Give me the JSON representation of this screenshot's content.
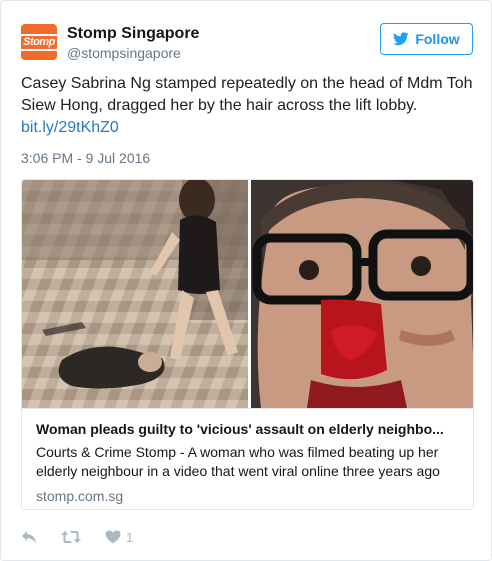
{
  "account": {
    "display_name": "Stomp Singapore",
    "handle": "@stompsingapore",
    "avatar_text": "Stomp"
  },
  "follow_button": {
    "label": "Follow"
  },
  "tweet": {
    "text": "Casey Sabrina Ng stamped repeatedly on the head of Mdm Toh Siew Hong, dragged her by the hair across the lift lobby.",
    "link": "bit.ly/29tKhZ0",
    "timestamp": "3:06 PM - 9 Jul 2016"
  },
  "card": {
    "title": "Woman pleads guilty to 'vicious' assault on elderly neighbo...",
    "description": "Courts & Crime Stomp - A woman who was filmed beating up her elderly neighbour in a video that went viral online three years ago",
    "domain": "stomp.com.sg"
  },
  "actions": {
    "reply_icon": "reply-icon",
    "retweet_icon": "retweet-icon",
    "like_icon": "heart-icon",
    "like_count": "1"
  },
  "colors": {
    "brand_blue": "#1da1f2",
    "link_blue": "#2b7bb9",
    "avatar_orange": "#f26b2a",
    "muted": "#657786"
  }
}
